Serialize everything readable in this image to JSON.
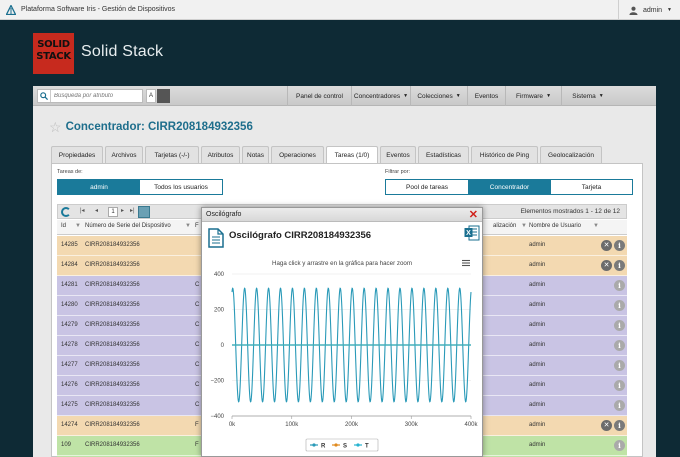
{
  "app": {
    "title": "Plataforma Software Iris - Gestión de Dispositivos",
    "user": "admin",
    "brand_logo_line1": "SOLID",
    "brand_logo_line2": "STACK",
    "brand_name": "Solid Stack"
  },
  "nav": {
    "search_placeholder": "Búsqueda por atributo",
    "a_label": "A",
    "items": [
      {
        "label": "Panel de control",
        "caret": false
      },
      {
        "label": "Concentradores",
        "caret": true
      },
      {
        "label": "Colecciones",
        "caret": true
      },
      {
        "label": "Eventos",
        "caret": false
      },
      {
        "label": "Firmware",
        "caret": true
      },
      {
        "label": "Sistema",
        "caret": true
      }
    ]
  },
  "page": {
    "title_prefix": "Concentrador: ",
    "title_id": "CIRR208184932356",
    "tabs": [
      {
        "label": "Propiedades",
        "active": false
      },
      {
        "label": "Archivos",
        "active": false
      },
      {
        "label": "Tarjetas (-/-)",
        "active": false
      },
      {
        "label": "Atributos",
        "active": false
      },
      {
        "label": "Notas",
        "active": false
      },
      {
        "label": "Operaciones",
        "active": false
      },
      {
        "label": "Tareas (1/0)",
        "active": true
      },
      {
        "label": "Eventos",
        "active": false
      },
      {
        "label": "Estadísticas",
        "active": false
      },
      {
        "label": "Histórico de Ping",
        "active": false
      },
      {
        "label": "Geolocalización",
        "active": false
      }
    ]
  },
  "filters": {
    "tasks_of_label": "Tareas de:",
    "tasks_of_options": [
      {
        "label": "admin",
        "on": true
      },
      {
        "label": "Todos los usuarios",
        "on": false
      }
    ],
    "filter_by_label": "Filtrar por:",
    "filter_by_options": [
      {
        "label": "Pool de tareas",
        "on": false
      },
      {
        "label": "Concentrador",
        "on": true
      },
      {
        "label": "Tarjeta",
        "on": false
      }
    ]
  },
  "table": {
    "page": "1",
    "count_text": "Elementos mostrados 1 - 12 de 12",
    "headers": [
      "Id",
      "Número de Serie del Dispositivo",
      "F",
      "alización",
      "Nombre de Usuario"
    ],
    "row_color_names": {
      "orange": "#f3d9b1",
      "purple": "#c9c4e4",
      "green": "#bfe3a6"
    },
    "rows": [
      {
        "id": "14285",
        "serial": "CIRR208184932356",
        "t": "",
        "user": "admin",
        "color": "#f3d9b1",
        "x": true
      },
      {
        "id": "14284",
        "serial": "CIRR208184932356",
        "t": "",
        "user": "admin",
        "color": "#f3d9b1",
        "x": true
      },
      {
        "id": "14281",
        "serial": "CIRR208184932356",
        "t": "C",
        "user": "admin",
        "color": "#c9c4e4",
        "x": false
      },
      {
        "id": "14280",
        "serial": "CIRR208184932356",
        "t": "C",
        "user": "admin",
        "color": "#c9c4e4",
        "x": false
      },
      {
        "id": "14279",
        "serial": "CIRR208184932356",
        "t": "C",
        "user": "admin",
        "color": "#c9c4e4",
        "x": false
      },
      {
        "id": "14278",
        "serial": "CIRR208184932356",
        "t": "C",
        "user": "admin",
        "color": "#c9c4e4",
        "x": false
      },
      {
        "id": "14277",
        "serial": "CIRR208184932356",
        "t": "C",
        "user": "admin",
        "color": "#c9c4e4",
        "x": false
      },
      {
        "id": "14276",
        "serial": "CIRR208184932356",
        "t": "C",
        "user": "admin",
        "color": "#c9c4e4",
        "x": false
      },
      {
        "id": "14275",
        "serial": "CIRR208184932356",
        "t": "C",
        "user": "admin",
        "color": "#c9c4e4",
        "x": false
      },
      {
        "id": "14274",
        "serial": "CIRR208184932356",
        "t": "F",
        "user": "admin",
        "color": "#f3d9b1",
        "x": true
      },
      {
        "id": "109",
        "serial": "CIRR208184932356",
        "t": "F",
        "user": "admin",
        "color": "#bfe3a6",
        "x": false
      },
      {
        "id": "",
        "serial": "",
        "t": "",
        "user": "",
        "color": "#bfe3a6",
        "x": false
      }
    ]
  },
  "modal": {
    "window_title": "Oscilógrafo",
    "title": "Oscilógrafo CIRR208184932356",
    "zoom_hint": "Haga click y arrastre en la gráfica para hacer zoom",
    "close_icon": "close-icon",
    "export_icon": "excel-icon"
  },
  "chart_data": {
    "type": "line",
    "title": "",
    "xlabel": "",
    "ylabel": "",
    "xlim": [
      0,
      400000
    ],
    "ylim": [
      -400,
      400
    ],
    "x_ticks": [
      "0k",
      "100k",
      "200k",
      "300k",
      "400k"
    ],
    "x_tick_values": [
      0,
      100000,
      200000,
      300000,
      400000
    ],
    "y_ticks": [
      "400",
      "200",
      "0",
      "−200",
      "−400"
    ],
    "y_tick_values": [
      400,
      200,
      0,
      -200,
      -400
    ],
    "grid": true,
    "legend_position": "bottom-center",
    "series": [
      {
        "name": "R",
        "color": "#2a9ab8",
        "shape": "sine",
        "amplitude": 320,
        "cycles": 20,
        "offset": 0
      },
      {
        "name": "S",
        "color": "#e08a1e",
        "shape": "flat",
        "amplitude": 0,
        "offset": 0
      },
      {
        "name": "T",
        "color": "#27b3d0",
        "shape": "flat",
        "amplitude": 0,
        "offset": 0
      }
    ]
  }
}
